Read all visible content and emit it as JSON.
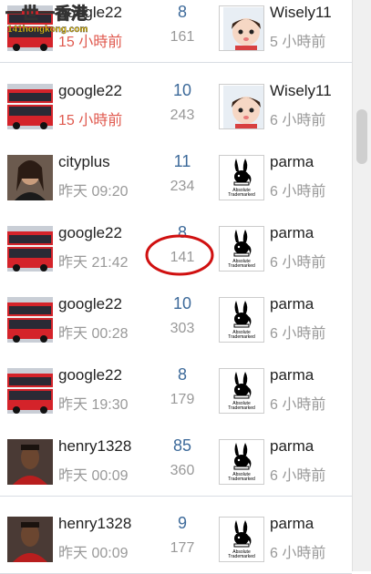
{
  "watermark": {
    "title": "一世一香港",
    "site": "141hongkong.com"
  },
  "topics": [
    {
      "author": "google22",
      "time": "15 小時前",
      "time_recent": true,
      "replies": "8",
      "views": "161",
      "last_user": "Wisely11",
      "last_time": "5 小時前",
      "thumb": "bus-thumbnail",
      "last_avatar": "cartoon-girl-avatar"
    },
    {
      "author": "google22",
      "time": "15 小時前",
      "time_recent": true,
      "replies": "10",
      "views": "243",
      "last_user": "Wisely11",
      "last_time": "6 小時前",
      "thumb": "bus-thumbnail",
      "last_avatar": "cartoon-girl-avatar"
    },
    {
      "author": "cityplus",
      "time": "昨天 09:20",
      "time_recent": false,
      "replies": "11",
      "views": "234",
      "last_user": "parma",
      "last_time": "6 小時前",
      "thumb": "woman-portrait-thumbnail",
      "last_avatar": "playboy-bunny-avatar"
    },
    {
      "author": "google22",
      "time": "昨天 21:42",
      "time_recent": false,
      "replies": "8",
      "views": "141",
      "last_user": "parma",
      "last_time": "6 小時前",
      "thumb": "bus-thumbnail",
      "last_avatar": "playboy-bunny-avatar"
    },
    {
      "author": "google22",
      "time": "昨天 00:28",
      "time_recent": false,
      "replies": "10",
      "views": "303",
      "last_user": "parma",
      "last_time": "6 小時前",
      "thumb": "bus-thumbnail",
      "last_avatar": "playboy-bunny-avatar"
    },
    {
      "author": "google22",
      "time": "昨天 19:30",
      "time_recent": false,
      "replies": "8",
      "views": "179",
      "last_user": "parma",
      "last_time": "6 小時前",
      "thumb": "bus-thumbnail",
      "last_avatar": "playboy-bunny-avatar"
    },
    {
      "author": "henry1328",
      "time": "昨天 00:09",
      "time_recent": false,
      "replies": "85",
      "views": "360",
      "last_user": "parma",
      "last_time": "6 小時前",
      "thumb": "man-portrait-thumbnail",
      "last_avatar": "playboy-bunny-avatar"
    },
    {
      "author": "henry1328",
      "time": "昨天 00:09",
      "time_recent": false,
      "replies": "9",
      "views": "177",
      "last_user": "parma",
      "last_time": "6 小時前",
      "thumb": "man-portrait-thumbnail",
      "last_avatar": "playboy-bunny-avatar"
    }
  ],
  "bunny_caption": "Absolute Trademarked",
  "colors": {
    "recent_time": "#e05a4f",
    "reply_count": "#3d6a9a",
    "muted": "#999999",
    "annotation": "#d01010"
  }
}
